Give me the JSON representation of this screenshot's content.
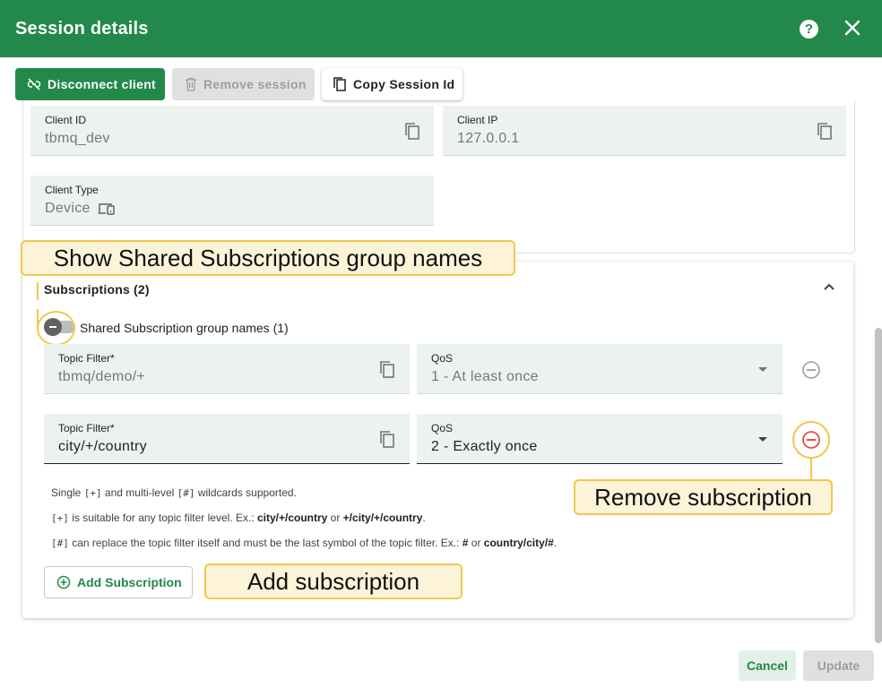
{
  "dialog": {
    "title": "Session details",
    "help_icon": "help-icon",
    "close_icon": "close-icon"
  },
  "toolbar": {
    "disconnect_label": "Disconnect client",
    "remove_label": "Remove session",
    "copy_label": "Copy Session Id"
  },
  "client": {
    "id_label": "Client ID",
    "id_value": "tbmq_dev",
    "ip_label": "Client IP",
    "ip_value": "127.0.0.1",
    "type_label": "Client Type",
    "type_value": "Device"
  },
  "subscriptions": {
    "title": "Subscriptions (2)",
    "shared_toggle_label": "Shared Subscription group names (1)",
    "items": [
      {
        "filter_label": "Topic Filter*",
        "filter_value": "tbmq/demo/+",
        "qos_label": "QoS",
        "qos_value": "1 - At least once"
      },
      {
        "filter_label": "Topic Filter*",
        "filter_value": "city/+/country",
        "qos_label": "QoS",
        "qos_value": "2 - Exactly once"
      }
    ],
    "hint1_pre": "Single ",
    "hint1_code1": "[+]",
    "hint1_mid": " and multi-level ",
    "hint1_code2": "[#]",
    "hint1_post": " wildcards supported.",
    "hint2_code": "[+]",
    "hint2_pre": " is suitable for any topic filter level. Ex.: ",
    "hint2_ex1": "city/+/country",
    "hint2_or": " or ",
    "hint2_ex2": "+/city/+/country",
    "hint2_end": ".",
    "hint3_code": "[#]",
    "hint3_pre": " can replace the topic filter itself and must be the last symbol of the topic filter. Ex.: ",
    "hint3_ex1": "#",
    "hint3_or": " or ",
    "hint3_ex2": "country/city/#",
    "hint3_end": ".",
    "add_label": "Add Subscription"
  },
  "callouts": {
    "shared": "Show Shared Subscriptions group names",
    "remove": "Remove subscription",
    "add": "Add subscription"
  },
  "footer": {
    "cancel_label": "Cancel",
    "update_label": "Update"
  },
  "colors": {
    "primary": "#22894a",
    "callout_border": "#f0c84a",
    "callout_bg": "#fdf3d8",
    "danger": "#e53935"
  }
}
